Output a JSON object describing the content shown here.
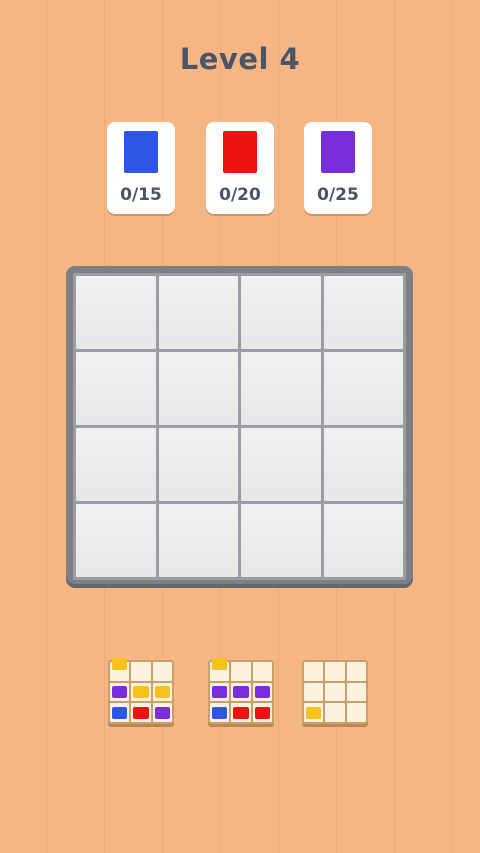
{
  "level": {
    "title": "Level 4"
  },
  "colors": {
    "blue": "#2e55e6",
    "red": "#ee1212",
    "purple": "#7a2ddb",
    "yellow": "#f7c21c"
  },
  "goals": [
    {
      "color": "blue",
      "progress": "0/15"
    },
    {
      "color": "red",
      "progress": "0/20"
    },
    {
      "color": "purple",
      "progress": "0/25"
    }
  ],
  "board": {
    "rows": 4,
    "cols": 4,
    "filled_cells": 0
  },
  "pieces": [
    {
      "name": "piece-1",
      "grid": [
        [
          "yellow",
          "",
          ""
        ],
        [
          "purple",
          "yellow",
          "yellow"
        ],
        [
          "blue",
          "red",
          "purple"
        ]
      ]
    },
    {
      "name": "piece-2",
      "grid": [
        [
          "yellow",
          "",
          ""
        ],
        [
          "purple",
          "purple",
          "purple"
        ],
        [
          "blue",
          "red",
          "red"
        ]
      ]
    },
    {
      "name": "piece-3",
      "grid": [
        [
          "",
          "",
          ""
        ],
        [
          "",
          "",
          ""
        ],
        [
          "yellow",
          "",
          ""
        ]
      ]
    }
  ]
}
